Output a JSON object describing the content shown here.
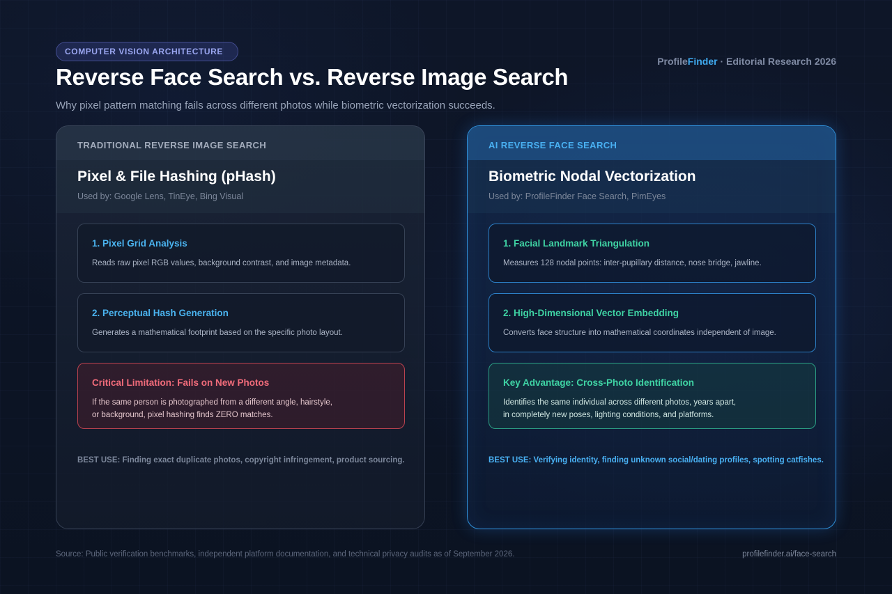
{
  "header": {
    "badge": "COMPUTER VISION ARCHITECTURE",
    "brand_part1": "Profile",
    "brand_part2": "Finder",
    "brand_rest": " · Editorial Research 2026",
    "title": "Reverse Face Search vs. Reverse Image Search",
    "subtitle": "Why pixel pattern matching fails across different photos while biometric vectorization succeeds."
  },
  "left_panel": {
    "label": "TRADITIONAL REVERSE IMAGE SEARCH",
    "title": "Pixel & File Hashing (pHash)",
    "used_by": "Used by: Google Lens, TinEye, Bing Visual",
    "cards": [
      {
        "title": "1. Pixel Grid Analysis",
        "lines": [
          "Reads raw pixel RGB values, background contrast, and image metadata."
        ]
      },
      {
        "title": "2. Perceptual Hash Generation",
        "lines": [
          "Generates a mathematical footprint based on the specific photo layout."
        ]
      },
      {
        "title": "Critical Limitation: Fails on New Photos",
        "lines": [
          "If the same person is photographed from a different angle, hairstyle,",
          "or background, pixel hashing finds ZERO matches."
        ]
      }
    ],
    "best_use": "BEST USE: Finding exact duplicate photos, copyright infringement, product sourcing."
  },
  "right_panel": {
    "label": "AI REVERSE FACE SEARCH",
    "title": "Biometric Nodal Vectorization",
    "used_by": "Used by: ProfileFinder Face Search, PimEyes",
    "cards": [
      {
        "title": "1. Facial Landmark Triangulation",
        "lines": [
          "Measures 128 nodal points: inter-pupillary distance, nose bridge, jawline."
        ]
      },
      {
        "title": "2. High-Dimensional Vector Embedding",
        "lines": [
          "Converts face structure into mathematical coordinates independent of image."
        ]
      },
      {
        "title": "Key Advantage: Cross-Photo Identification",
        "lines": [
          "Identifies the same individual across different photos, years apart,",
          "in completely new poses, lighting conditions, and platforms."
        ]
      }
    ],
    "best_use": "BEST USE: Verifying identity, finding unknown social/dating profiles, spotting catfishes."
  },
  "footer": {
    "source": "Source: Public verification benchmarks, independent platform documentation, and technical privacy audits as of September 2026.",
    "url": "profilefinder.ai/face-search"
  },
  "colors": {
    "accent_blue": "#49b0f2",
    "accent_green": "#3fd3a4",
    "warning_red": "#f06b7a"
  }
}
